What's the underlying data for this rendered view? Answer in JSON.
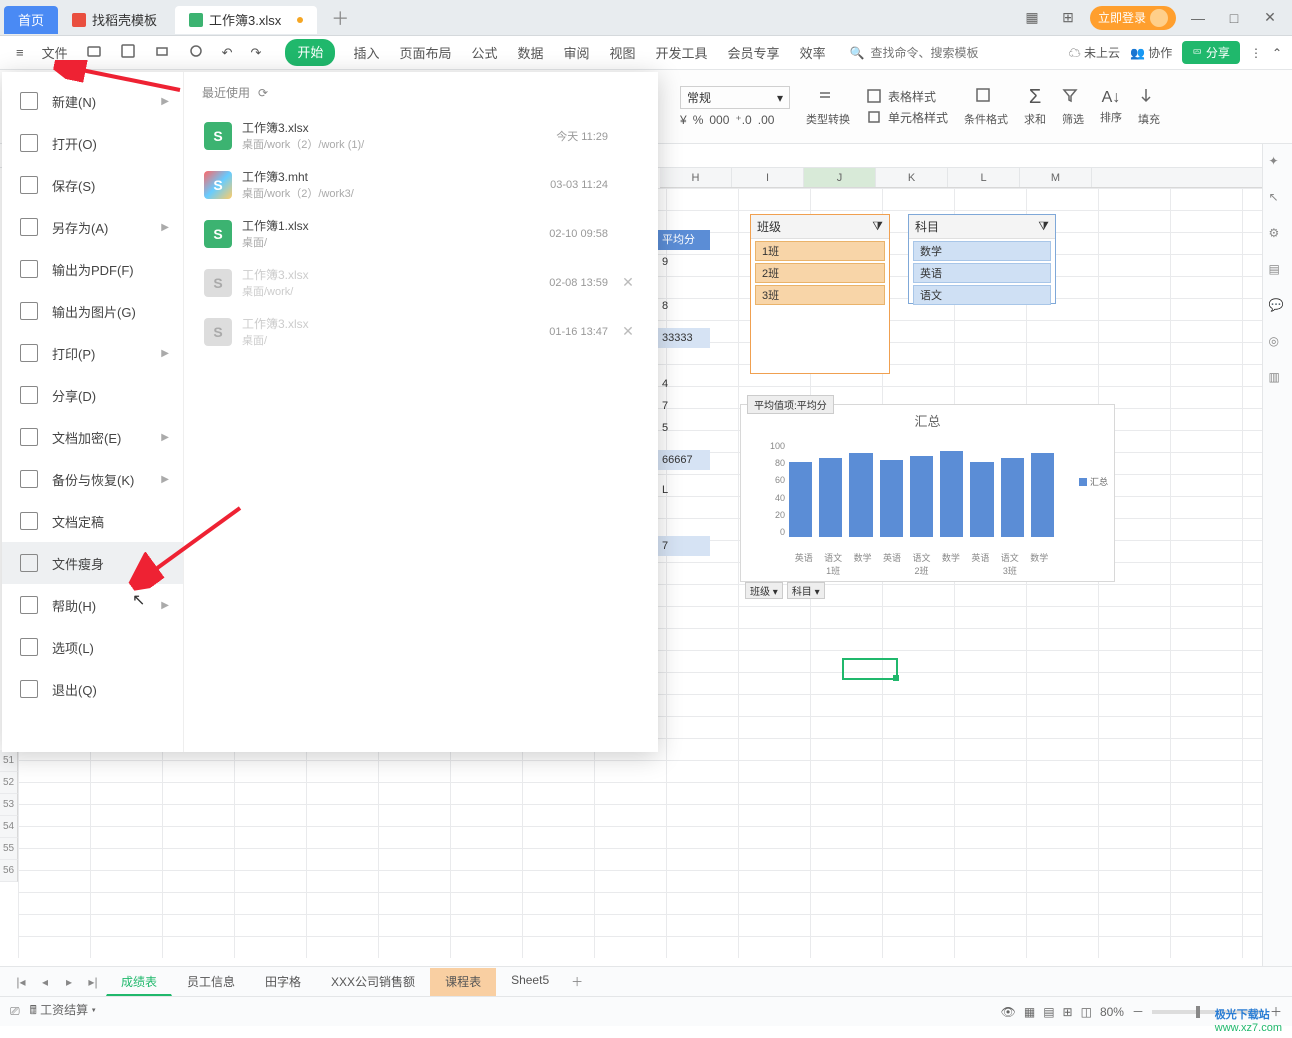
{
  "title_tabs": {
    "home": "首页",
    "template": "找稻壳模板",
    "doc": "工作簿3.xlsx"
  },
  "login_btn": "立即登录",
  "file_btn": "文件",
  "menu_tabs": [
    "开始",
    "插入",
    "页面布局",
    "公式",
    "数据",
    "审阅",
    "视图",
    "开发工具",
    "会员专享",
    "效率"
  ],
  "search_placeholder": "查找命令、搜索模板",
  "cloud_label": "未上云",
  "collab_label": "协作",
  "share_label": "分享",
  "ribbon": {
    "format_sel": "常规",
    "currency": "¥",
    "percent": "%",
    "comma": "，",
    "dec_inc": ".0",
    "dec_dec": ".00",
    "type_conv": "类型转换",
    "cond_fmt": "条件格式",
    "cell_style": "单元格样式",
    "table_style": "表格样式",
    "sum": "求和",
    "filter": "筛选",
    "sort": "排序",
    "fill": "填充"
  },
  "columns": [
    "H",
    "I",
    "J",
    "K",
    "L",
    "M"
  ],
  "visible_rows": [
    "51",
    "52",
    "53",
    "54",
    "55",
    "56"
  ],
  "cells": {
    "hdr": "平均分",
    "r1": "9",
    "r2": "8",
    "r3": "33333",
    "r4": "4",
    "r5": "7",
    "r6": "5",
    "r7": "66667",
    "r8": "L",
    "r9": "7"
  },
  "slicer1": {
    "title": "班级",
    "items": [
      "1班",
      "2班",
      "3班"
    ]
  },
  "slicer2": {
    "title": "科目",
    "items": [
      "数学",
      "英语",
      "语文"
    ]
  },
  "chart": {
    "tag": "平均值项:平均分",
    "title": "汇总",
    "legend": "汇总",
    "filters": [
      "班级",
      "科目"
    ]
  },
  "chart_data": {
    "type": "bar",
    "title": "汇总",
    "ylabel": "",
    "xlabel": "",
    "ylim": [
      0,
      100
    ],
    "yticks": [
      0,
      20,
      40,
      60,
      80,
      100
    ],
    "groups": [
      "1班",
      "2班",
      "3班"
    ],
    "sub_categories": [
      "英语",
      "语文",
      "数学"
    ],
    "series": [
      {
        "name": "汇总",
        "values": [
          78,
          82,
          88,
          80,
          84,
          90,
          78,
          82,
          88
        ]
      }
    ]
  },
  "file_menu": {
    "items": [
      {
        "label": "新建(N)",
        "arrow": true
      },
      {
        "label": "打开(O)"
      },
      {
        "label": "保存(S)"
      },
      {
        "label": "另存为(A)",
        "arrow": true
      },
      {
        "label": "输出为PDF(F)"
      },
      {
        "label": "输出为图片(G)"
      },
      {
        "label": "打印(P)",
        "arrow": true
      },
      {
        "label": "分享(D)"
      },
      {
        "label": "文档加密(E)",
        "arrow": true
      },
      {
        "label": "备份与恢复(K)",
        "arrow": true
      },
      {
        "label": "文档定稿"
      },
      {
        "label": "文件瘦身",
        "selected": true
      },
      {
        "label": "帮助(H)",
        "arrow": true
      },
      {
        "label": "选项(L)"
      },
      {
        "label": "退出(Q)"
      }
    ],
    "recent_header": "最近使用",
    "recent": [
      {
        "name": "工作簿3.xlsx",
        "path": "桌面/work（2）/work (1)/",
        "time": "今天 11:29",
        "ic": "green"
      },
      {
        "name": "工作簿3.mht",
        "path": "桌面/work（2）/work3/",
        "time": "03-03 11:24",
        "ic": "rainbow"
      },
      {
        "name": "工作簿1.xlsx",
        "path": "桌面/",
        "time": "02-10 09:58",
        "ic": "green"
      },
      {
        "name": "工作簿3.xlsx",
        "path": "桌面/work/",
        "time": "02-08 13:59",
        "ic": "grey",
        "dim": true,
        "close": true
      },
      {
        "name": "工作簿3.xlsx",
        "path": "桌面/",
        "time": "01-16 13:47",
        "ic": "grey",
        "dim": true,
        "close": true
      }
    ]
  },
  "sheet_tabs": [
    "成绩表",
    "员工信息",
    "田字格",
    "XXX公司销售额",
    "课程表",
    "Sheet5"
  ],
  "active_sheet": "成绩表",
  "orange_sheet": "课程表",
  "status": {
    "salary": "工资结算",
    "zoom": "80%"
  },
  "watermark": {
    "a": "极光下载站",
    "b": "www.xz7.com"
  }
}
